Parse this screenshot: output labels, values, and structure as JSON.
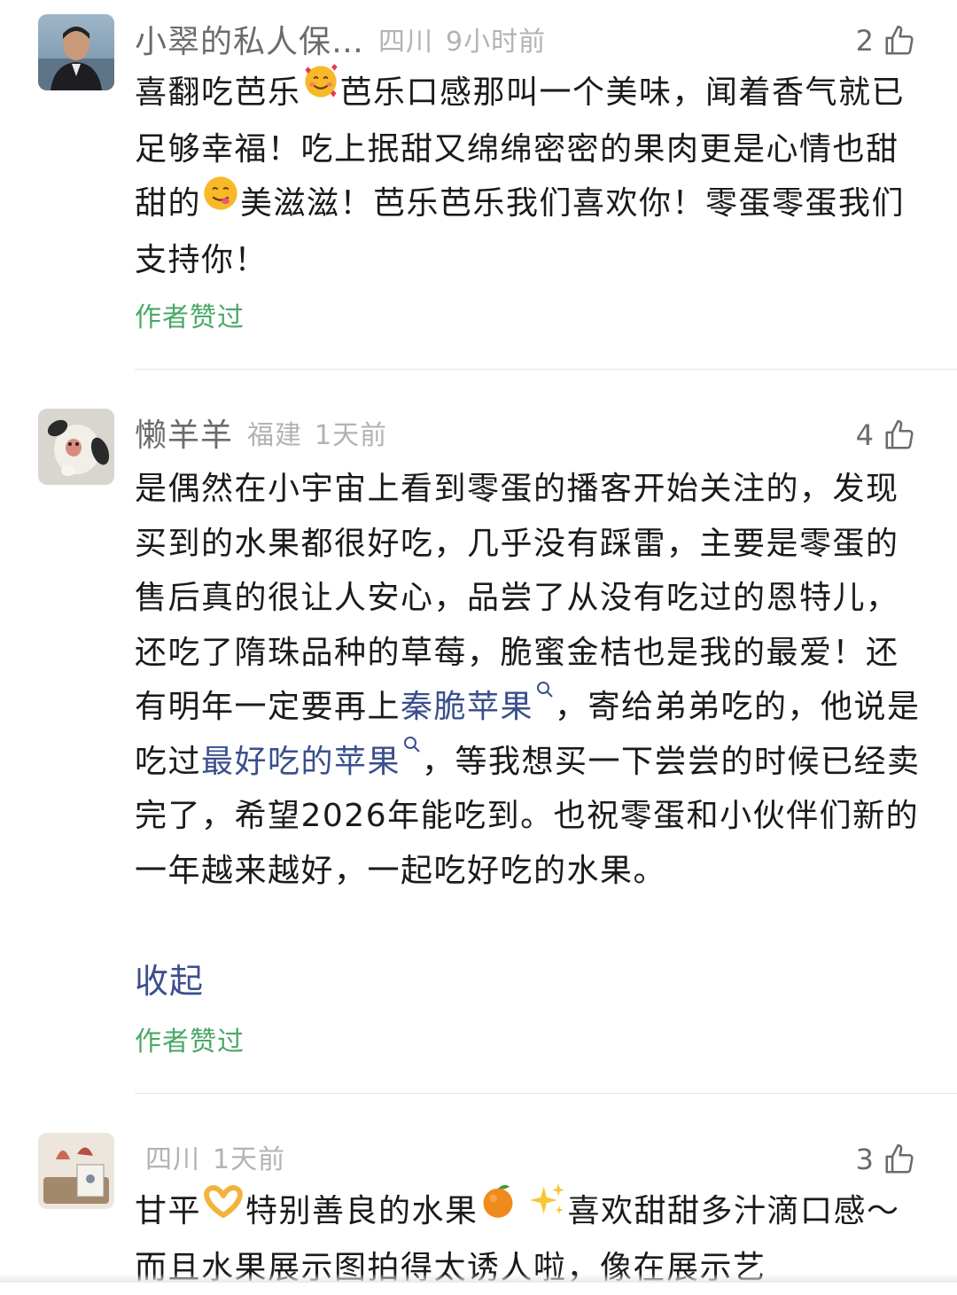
{
  "comments": [
    {
      "nickname": "小翠的私人保…",
      "location": "四川",
      "time": "9小时前",
      "like_count": "2",
      "text_part1": "喜翻吃芭乐",
      "emoji1": "smiling-face-with-hearts",
      "text_part2": "芭乐口感那叫一个美味，闻着香气就已足够幸福！吃上抿甜又绵绵密密的果肉更是心情也甜甜的",
      "emoji2": "face-savoring-food",
      "text_part3": "美滋滋！芭乐芭乐我们喜欢你！零蛋零蛋我们支持你！",
      "author_liked": "作者赞过"
    },
    {
      "nickname": "懒羊羊",
      "location": "福建",
      "time": "1天前",
      "like_count": "4",
      "text_part1": "是偶然在小宇宙上看到零蛋的播客开始关注的，发现买到的水果都很好吃，几乎没有踩雷，主要是零蛋的售后真的很让人安心，品尝了从没有吃过的恩特儿，还吃了隋珠品种的草莓，脆蜜金桔也是我的最爱！还有明年一定要再上",
      "link1": "秦脆苹果",
      "text_part2": "，寄给弟弟吃的，他说是吃过",
      "link2": "最好吃的苹果",
      "text_part3": "，等我想买一下尝尝的时候已经卖完了，希望2026年能吃到。也祝零蛋和小伙伴们新的一年越来越好，一起吃好吃的水果。",
      "collapse_label": "收起",
      "author_liked": "作者赞过"
    },
    {
      "location": "四川",
      "time": "1天前",
      "like_count": "3",
      "text_part1": "甘平",
      "emoji1": "heart-hands",
      "text_part2": "特别善良的水果",
      "emoji2": "tangerine",
      "emoji3": "sparkles",
      "text_part3": "喜欢甜甜多汁滴口感～而且水果展示图拍得太诱人啦，像在展示艺"
    }
  ]
}
